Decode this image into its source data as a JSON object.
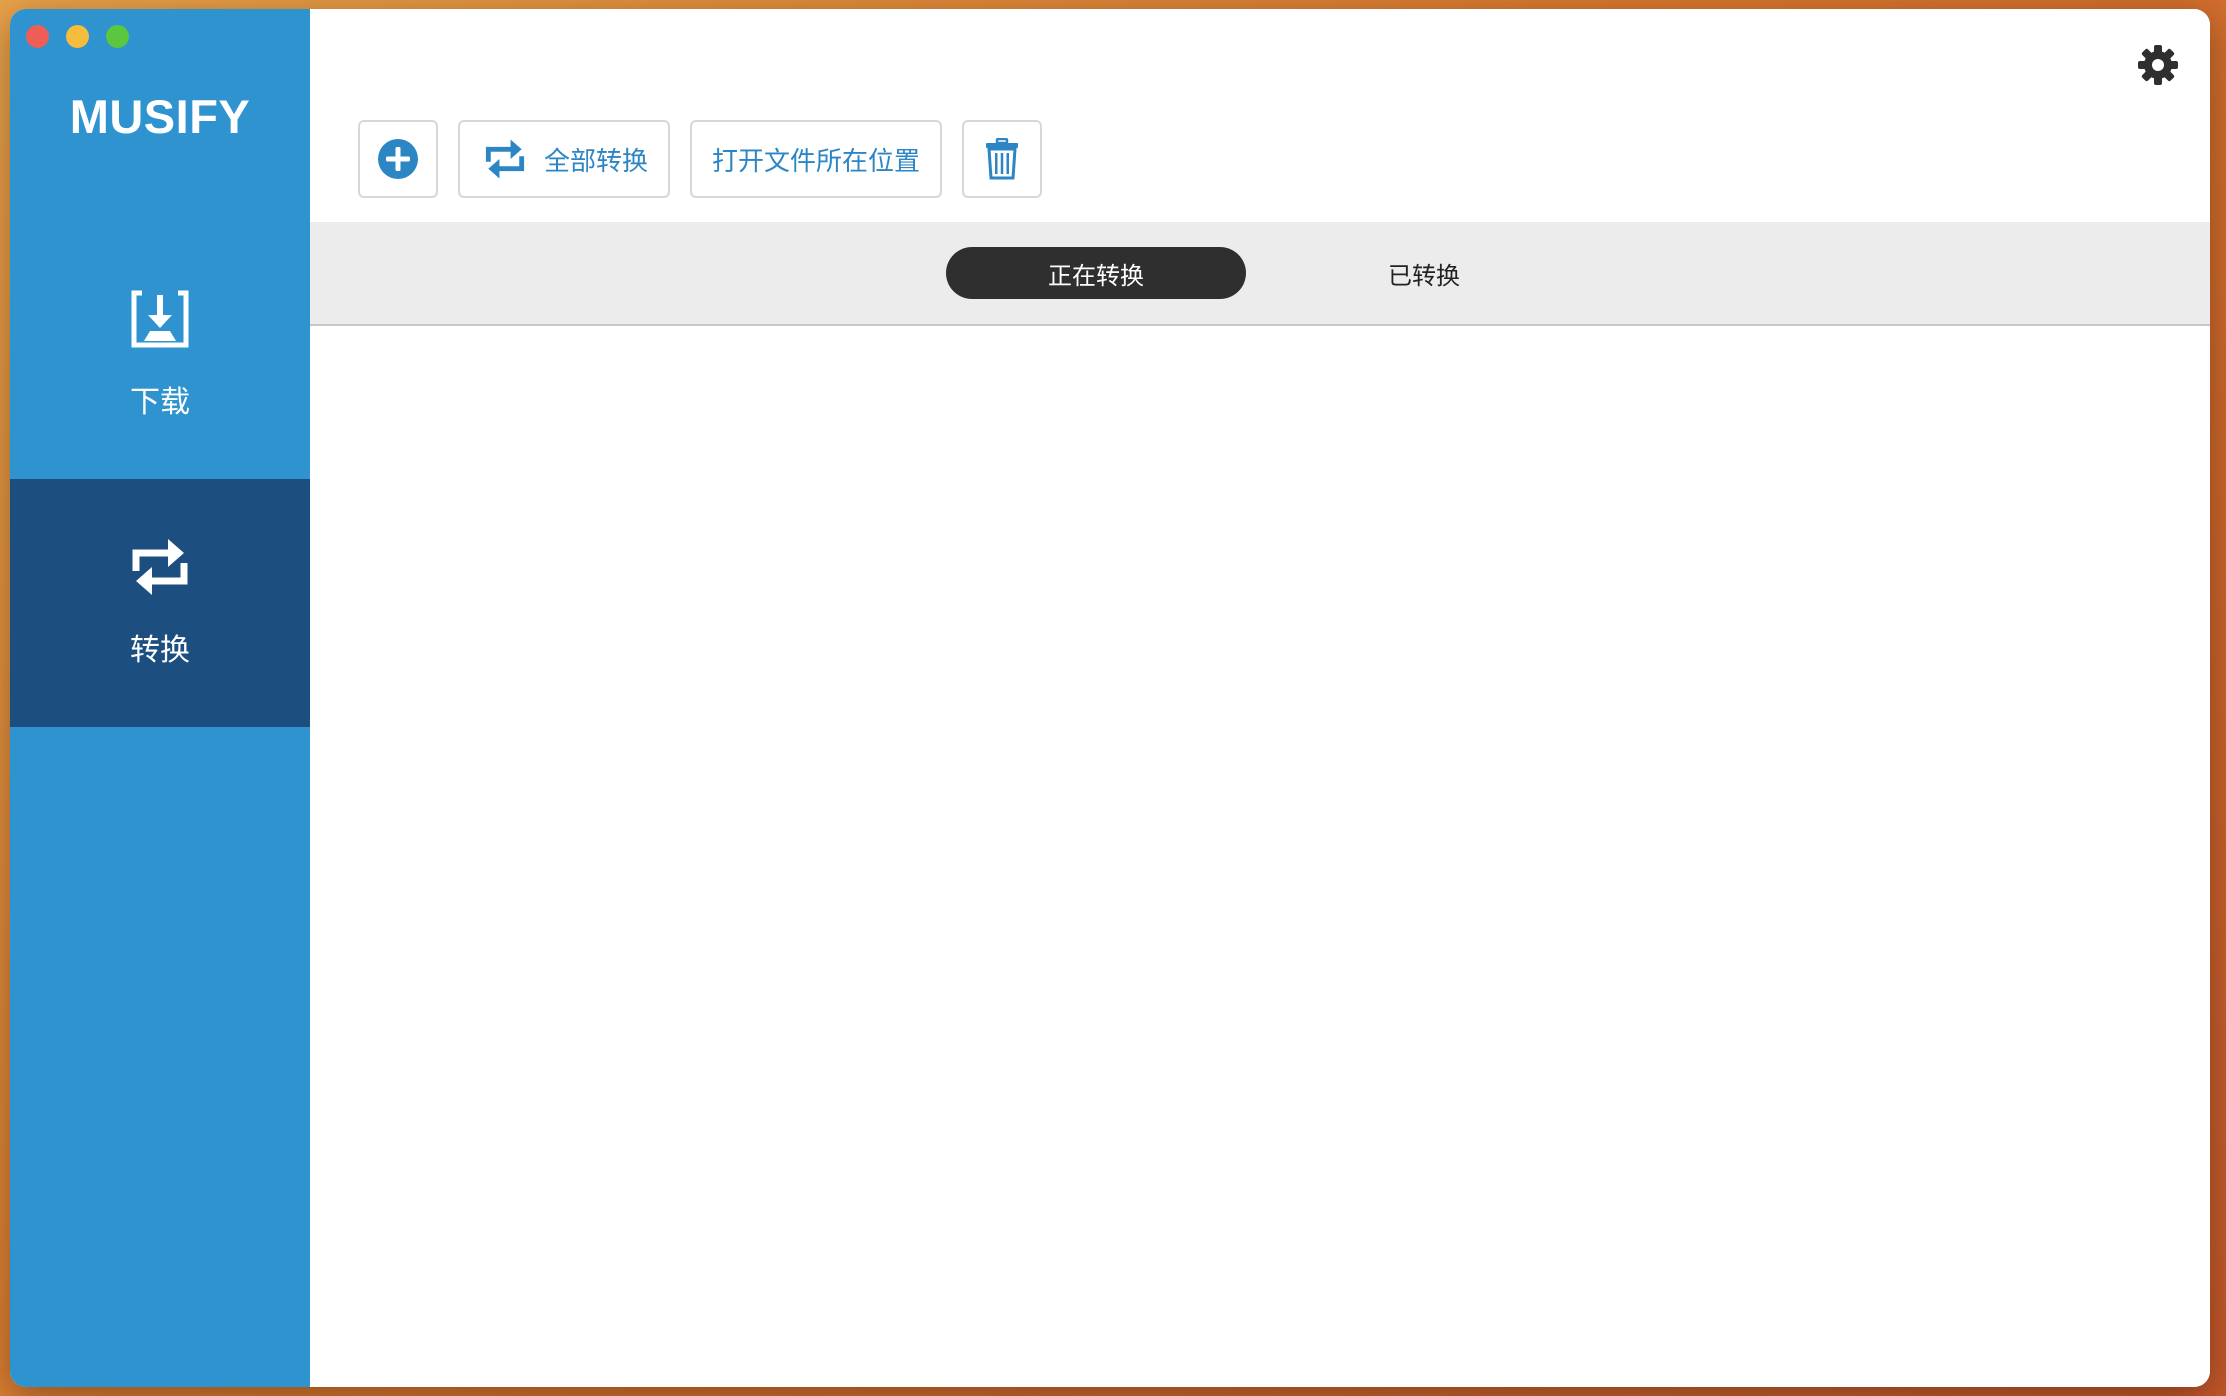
{
  "sidebar": {
    "brand": "MUSIFY",
    "items": [
      {
        "label": "下载",
        "icon": "download-icon",
        "active": false
      },
      {
        "label": "转换",
        "icon": "convert-icon",
        "active": true
      }
    ]
  },
  "toolbar": {
    "add_icon": "add-circle-icon",
    "convert_all_label": "全部转换",
    "open_location_label": "打开文件所在位置",
    "delete_icon": "trash-icon"
  },
  "tabs": [
    {
      "label": "正在转换",
      "active": true
    },
    {
      "label": "已转换",
      "active": false
    }
  ],
  "colors": {
    "sidebar": "#2f93cf",
    "sidebar_active": "#1c4e80",
    "accent": "#2c86c4",
    "tab_active": "#2f2f2f"
  }
}
